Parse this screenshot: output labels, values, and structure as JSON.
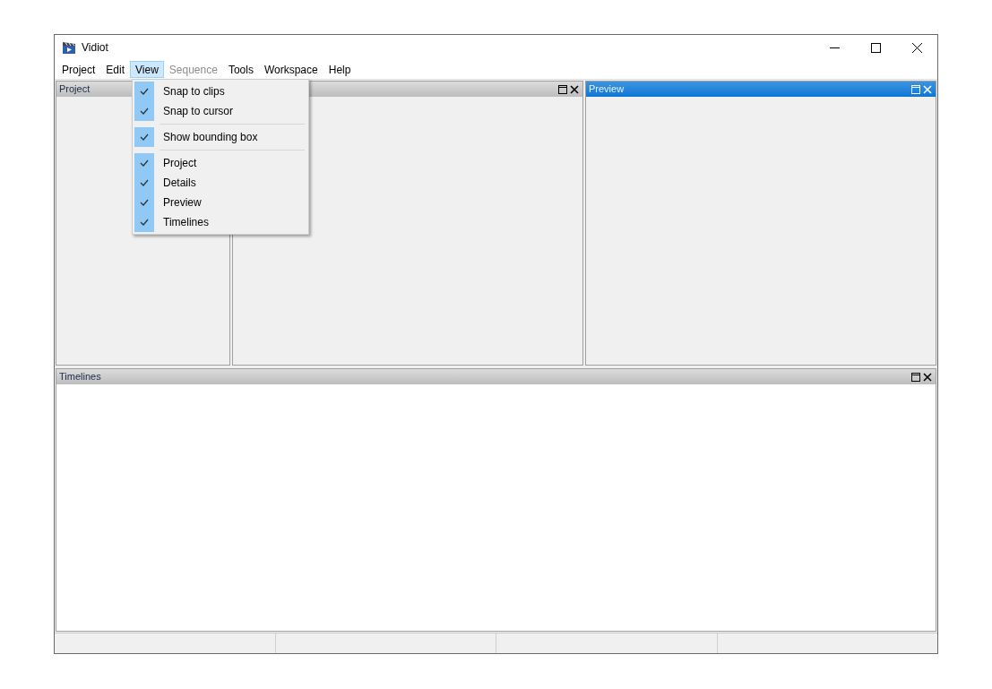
{
  "window": {
    "title": "Vidiot"
  },
  "menu_bar": [
    {
      "label": "Project",
      "selected": false,
      "disabled": false
    },
    {
      "label": "Edit",
      "selected": false,
      "disabled": false
    },
    {
      "label": "View",
      "selected": true,
      "disabled": false
    },
    {
      "label": "Sequence",
      "selected": false,
      "disabled": true
    },
    {
      "label": "Tools",
      "selected": false,
      "disabled": false
    },
    {
      "label": "Workspace",
      "selected": false,
      "disabled": false
    },
    {
      "label": "Help",
      "selected": false,
      "disabled": false
    }
  ],
  "view_menu": {
    "groups": [
      [
        {
          "label": "Snap to clips",
          "checked": true
        },
        {
          "label": "Snap to cursor",
          "checked": true
        }
      ],
      [
        {
          "label": "Show bounding box",
          "checked": true
        }
      ],
      [
        {
          "label": "Project",
          "checked": true
        },
        {
          "label": "Details",
          "checked": true
        },
        {
          "label": "Preview",
          "checked": true
        },
        {
          "label": "Timelines",
          "checked": true
        }
      ]
    ]
  },
  "panes": [
    {
      "title": "Project",
      "selected": false
    },
    {
      "selected": false
    },
    {
      "title": "Preview",
      "selected": true
    }
  ],
  "timelines": {
    "title": "Timelines",
    "selected": false
  }
}
